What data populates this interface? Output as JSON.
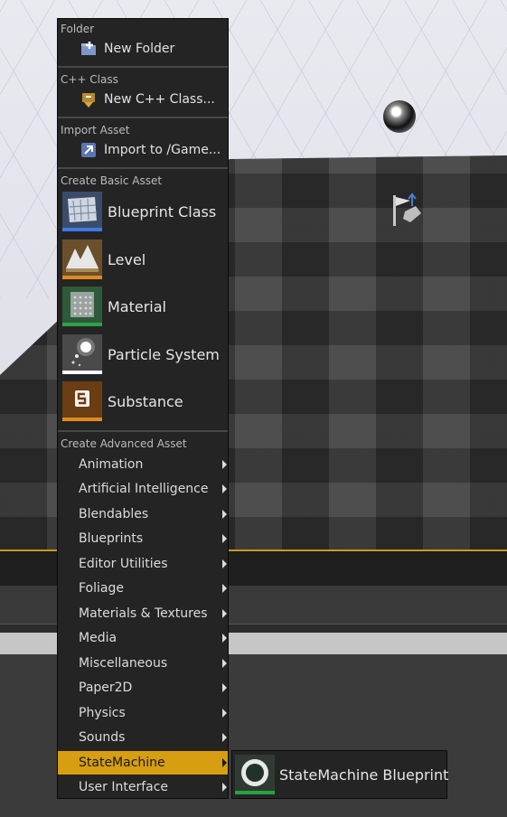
{
  "colors": {
    "menu_bg": "#242424",
    "highlight": "#d69e10",
    "blueprint_bar": "#3f7be0",
    "level_bar": "#e08a1e",
    "material_bar": "#2ea24a",
    "particle_bar": "#ffffff",
    "substance_bar": "#e08a1e",
    "statemachine_bar": "#25a53d"
  },
  "menu": {
    "folder": {
      "header": "Folder",
      "item": {
        "label": "New Folder",
        "icon": "new-folder-icon"
      }
    },
    "cpp": {
      "header": "C++ Class",
      "item": {
        "label": "New C++ Class...",
        "icon": "cpp-class-icon"
      }
    },
    "import": {
      "header": "Import Asset",
      "item": {
        "label": "Import to /Game...",
        "icon": "import-icon"
      }
    },
    "basic": {
      "header": "Create Basic Asset",
      "items": [
        {
          "label": "Blueprint Class",
          "icon": "blueprint-class-icon"
        },
        {
          "label": "Level",
          "icon": "level-icon"
        },
        {
          "label": "Material",
          "icon": "material-icon"
        },
        {
          "label": "Particle System",
          "icon": "particle-system-icon"
        },
        {
          "label": "Substance",
          "icon": "substance-icon"
        }
      ]
    },
    "advanced": {
      "header": "Create Advanced Asset",
      "items": [
        {
          "label": "Animation"
        },
        {
          "label": "Artificial Intelligence"
        },
        {
          "label": "Blendables"
        },
        {
          "label": "Blueprints"
        },
        {
          "label": "Editor Utilities"
        },
        {
          "label": "Foliage"
        },
        {
          "label": "Materials & Textures"
        },
        {
          "label": "Media"
        },
        {
          "label": "Miscellaneous"
        },
        {
          "label": "Paper2D"
        },
        {
          "label": "Physics"
        },
        {
          "label": "Sounds"
        },
        {
          "label": "StateMachine",
          "active": true
        },
        {
          "label": "User Interface"
        }
      ]
    }
  },
  "submenu": {
    "item": {
      "label": "StateMachine Blueprint",
      "icon": "statemachine-blueprint-icon"
    }
  }
}
